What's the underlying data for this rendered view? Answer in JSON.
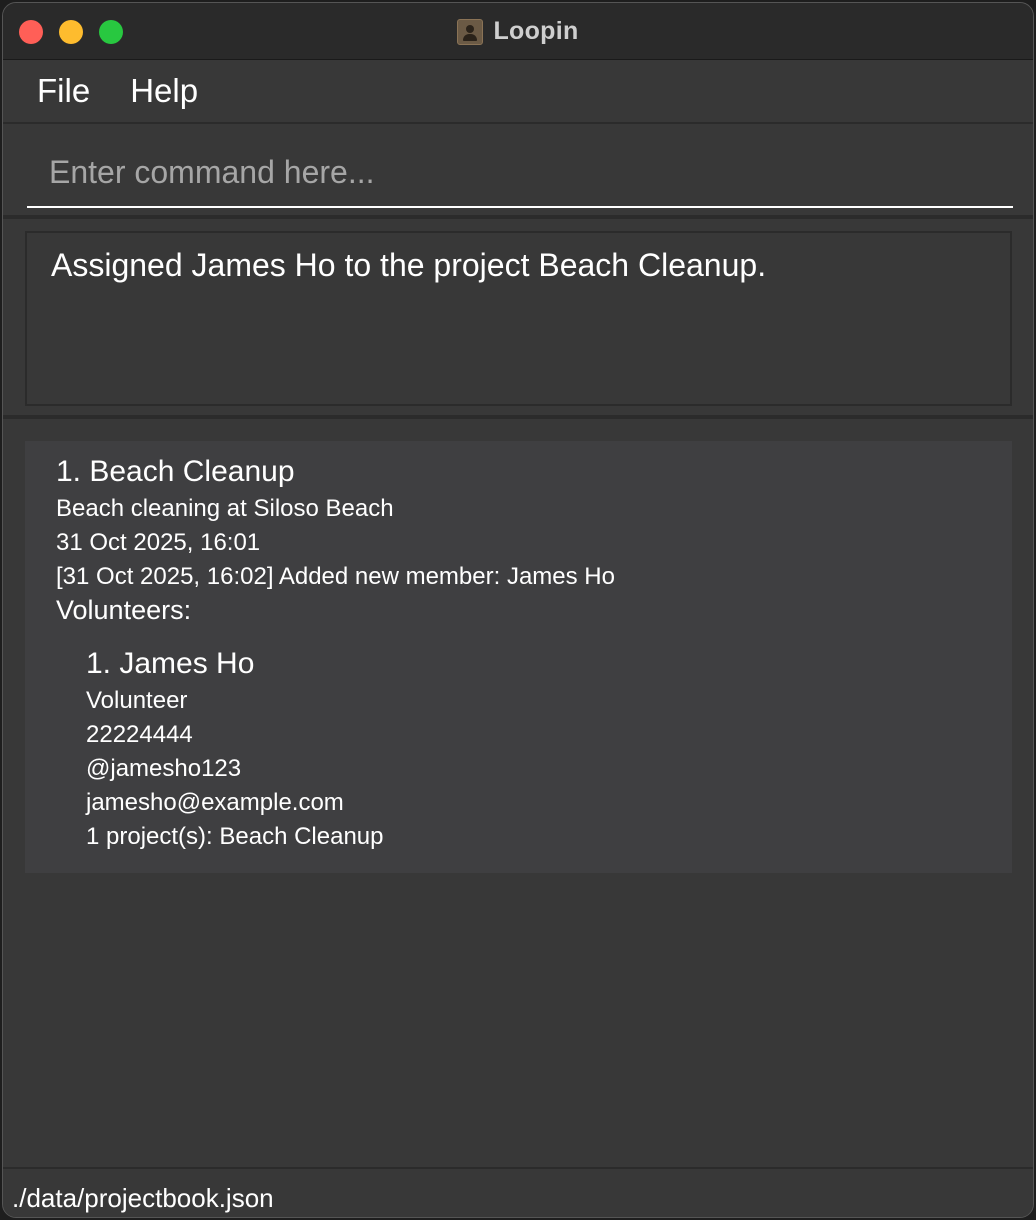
{
  "window": {
    "title": "Loopin",
    "traffic_lights": {
      "close": "#ff5f57",
      "minimize": "#febc2e",
      "maximize": "#28c840"
    }
  },
  "menu": {
    "file": "File",
    "help": "Help"
  },
  "command": {
    "value": "",
    "placeholder": "Enter command here..."
  },
  "result": {
    "message": "Assigned James Ho to the project Beach Cleanup."
  },
  "projects": [
    {
      "title": "1. Beach Cleanup",
      "description": "Beach cleaning at Siloso Beach",
      "datetime": "31 Oct 2025, 16:01",
      "log": "[31 Oct 2025, 16:02] Added new member: James Ho",
      "volunteers_header": "Volunteers:",
      "volunteers": [
        {
          "name": "1. James Ho",
          "role": "Volunteer",
          "phone": "22224444",
          "handle": "@jamesho123",
          "email": "jamesho@example.com",
          "projects": "1 project(s): Beach Cleanup"
        }
      ]
    }
  ],
  "status": {
    "path": "./data/projectbook.json"
  },
  "colors": {
    "background": "#383838",
    "card": "#3f3f41",
    "titlebar": "#2a2a2a",
    "text": "#ffffff",
    "placeholder": "#a6a6a6"
  }
}
